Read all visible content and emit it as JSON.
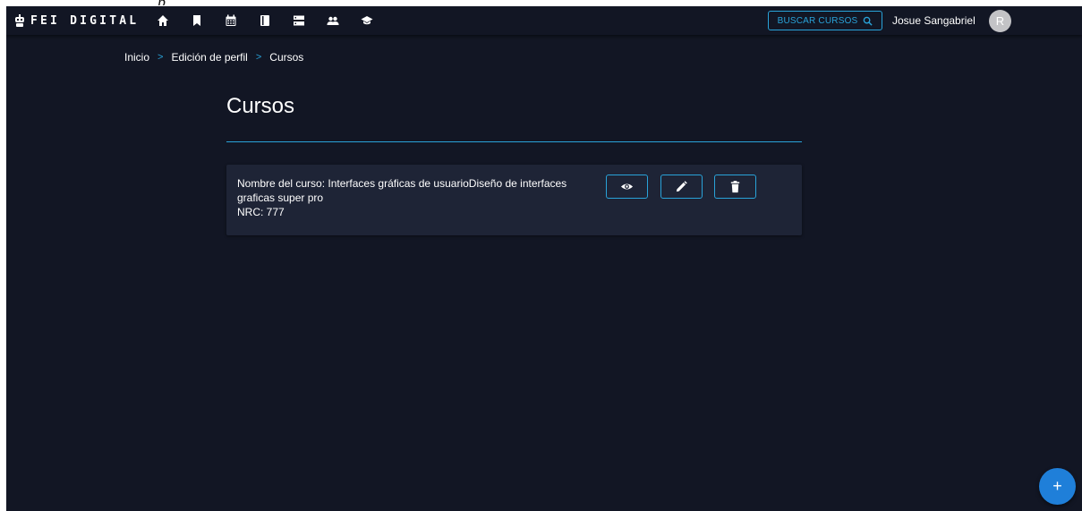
{
  "top_fragment": "p",
  "navbar": {
    "brand": "FEI DIGITAL",
    "icons": [
      "home-icon",
      "bookmark-icon",
      "calendar-icon",
      "book-icon",
      "storage-icon",
      "people-icon",
      "graduation-cap-icon"
    ],
    "search_label": "BUSCAR CURSOS",
    "username": "Josue Sangabriel",
    "avatar_initial": "R"
  },
  "breadcrumb": {
    "items": [
      "Inicio",
      "Edición de perfil",
      "Cursos"
    ],
    "separator": ">"
  },
  "page": {
    "title": "Cursos"
  },
  "courses": [
    {
      "name_line": "Nombre del curso: Interfaces gráficas de usuarioDiseño de interfaces graficas super pro",
      "nrc_line": "NRC: 777"
    }
  ],
  "fab_label": "+",
  "colors": {
    "background": "#121624",
    "card": "#1e2436",
    "accent": "#29a3d9",
    "fab": "#1f7fd9"
  }
}
